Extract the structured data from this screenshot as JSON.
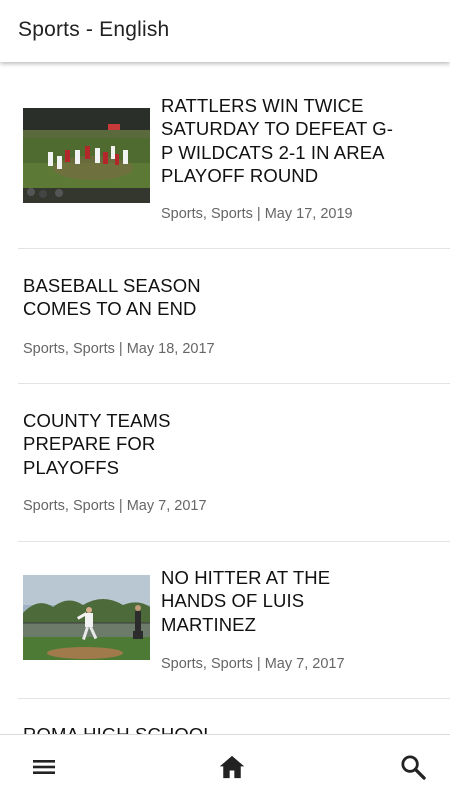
{
  "app_bar": {
    "title": "Sports - English"
  },
  "articles": [
    {
      "headline": "RATTLERS WIN TWICE SATURDAY TO DEFEAT G-P WILDCATS 2-1 IN AREA PLAYOFF ROUND",
      "categories": "Sports, Sports",
      "separator": "|",
      "date": "May 17, 2019",
      "has_image": true
    },
    {
      "headline": "BASEBALL SEASON COMES TO AN END",
      "categories": "Sports, Sports",
      "separator": "|",
      "date": "May 18, 2017",
      "has_image": false
    },
    {
      "headline": "COUNTY TEAMS PREPARE FOR PLAYOFFS",
      "categories": "Sports, Sports",
      "separator": "|",
      "date": "May 7, 2017",
      "has_image": false
    },
    {
      "headline": "NO HITTER AT THE HANDS OF LUIS MARTINEZ",
      "categories": "Sports, Sports",
      "separator": "|",
      "date": "May 7, 2017",
      "has_image": true
    },
    {
      "headline": "ROMA HIGH SCHOOL",
      "has_image": false
    }
  ],
  "bottom_nav": {
    "icons": [
      "menu-icon",
      "home-icon",
      "search-icon"
    ]
  },
  "colors": {
    "text": "#111111",
    "meta": "#666666",
    "divider": "#e3e3e3",
    "icon": "#222222"
  }
}
